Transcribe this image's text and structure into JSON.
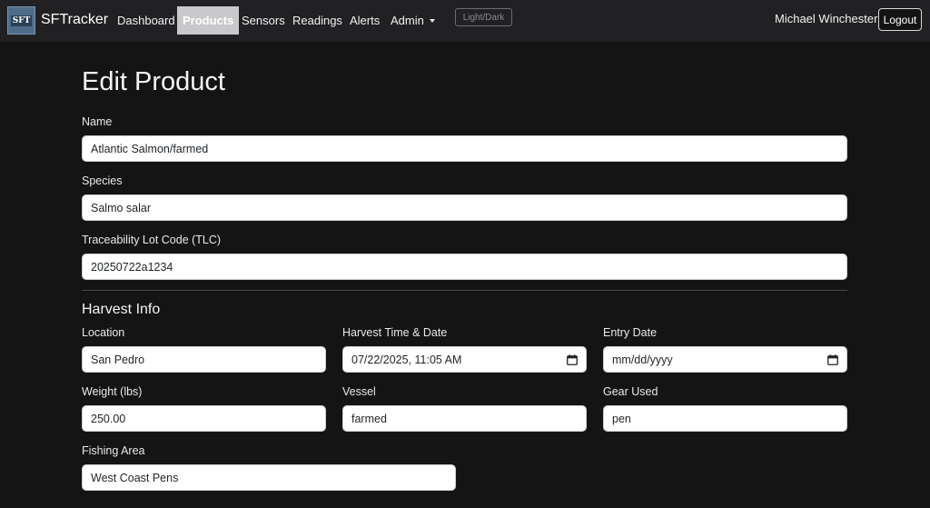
{
  "nav": {
    "logo_text": "SFT",
    "brand": "SFTracker",
    "links": [
      "Dashboard",
      "Products",
      "Sensors",
      "Readings",
      "Alerts",
      "Admin"
    ],
    "active_link": "Products",
    "theme_toggle": "Light/Dark",
    "user_name": "Michael Winchester",
    "logout": "Logout"
  },
  "page": {
    "title": "Edit Product"
  },
  "form": {
    "name": {
      "label": "Name",
      "value": "Atlantic Salmon/farmed"
    },
    "species": {
      "label": "Species",
      "value": "Salmo salar"
    },
    "tlc": {
      "label": "Traceability Lot Code (TLC)",
      "value": "20250722a1234"
    },
    "harvest_section_title": "Harvest Info",
    "location": {
      "label": "Location",
      "value": "San Pedro"
    },
    "harvest_time": {
      "label": "Harvest Time & Date",
      "value": "07/22/2025, 11:05 AM"
    },
    "entry_date": {
      "label": "Entry Date",
      "value": "mm/dd/yyyy"
    },
    "weight": {
      "label": "Weight (lbs)",
      "value": "250.00"
    },
    "vessel": {
      "label": "Vessel",
      "value": "farmed"
    },
    "gear": {
      "label": "Gear Used",
      "value": "pen"
    },
    "fishing_area": {
      "label": "Fishing Area",
      "value": "West Coast Pens"
    }
  },
  "icons": {
    "logo": "sft-logo",
    "dropdown": "chevron-down-icon",
    "date_picker": "calendar-icon"
  },
  "colors": {
    "background": "#141415",
    "navbar": "#212124",
    "active_nav": "#c9c9cb",
    "input_background": "#ffffff"
  }
}
